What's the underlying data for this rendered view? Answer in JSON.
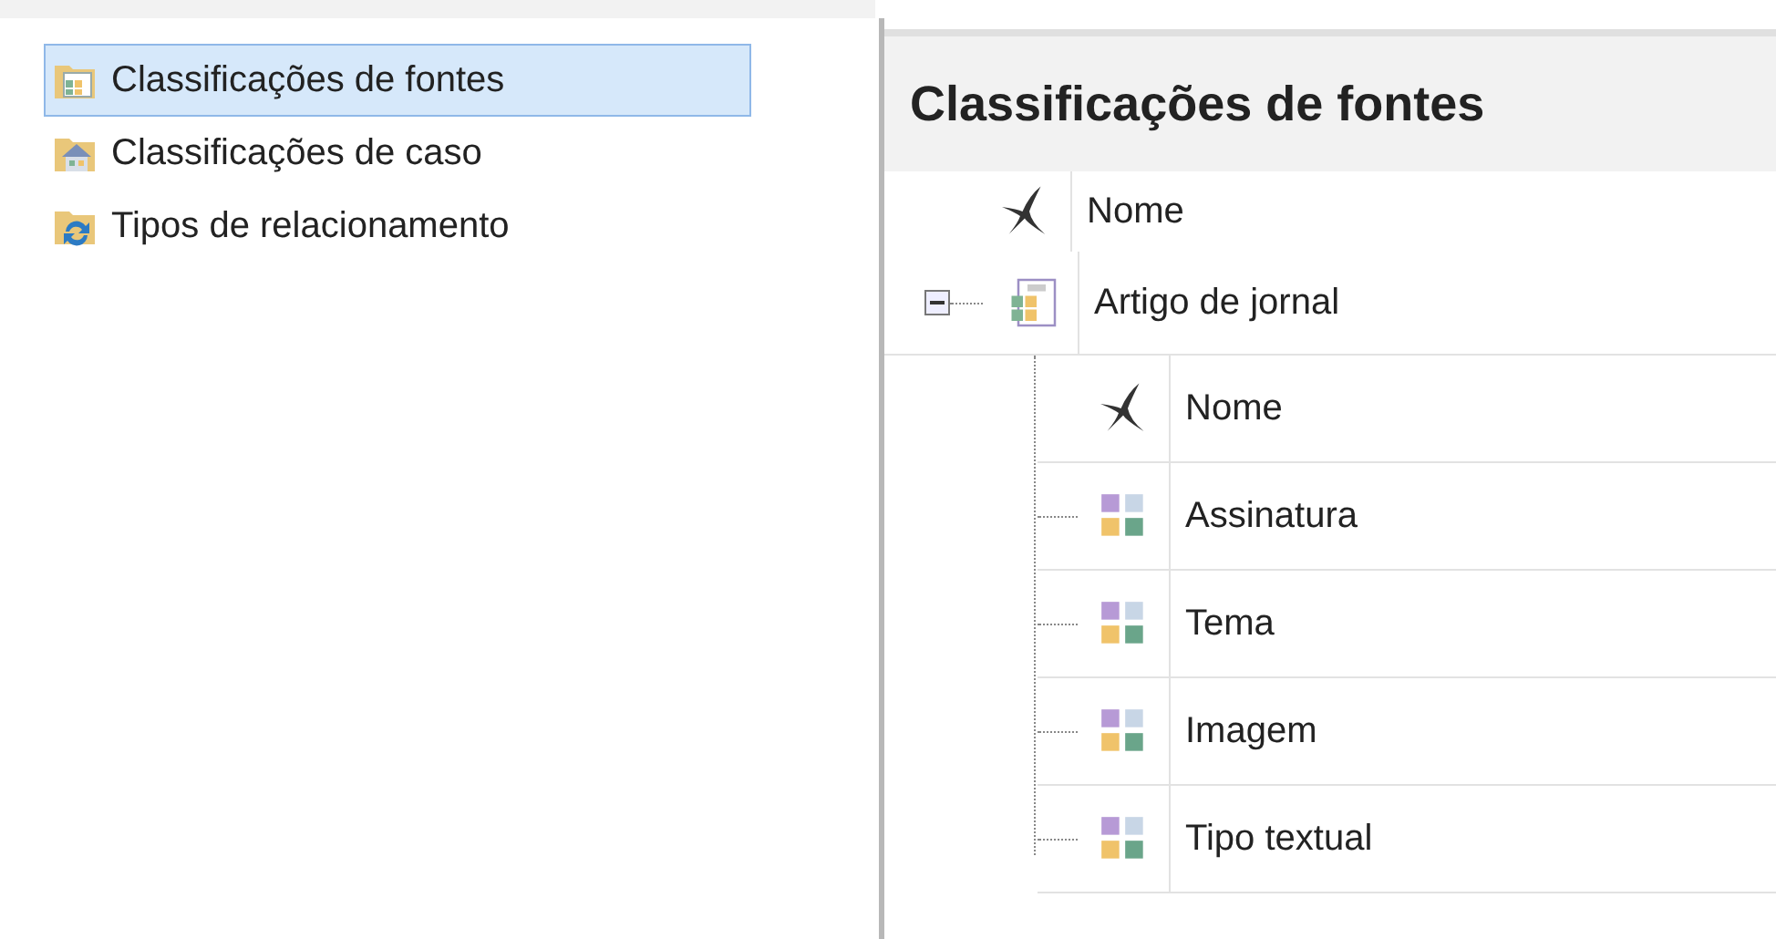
{
  "sidebar": {
    "items": [
      {
        "label": "Classificações de fontes",
        "selected": true,
        "kind": "source"
      },
      {
        "label": "Classificações de caso",
        "selected": false,
        "kind": "case"
      },
      {
        "label": "Tipos de relacionamento",
        "selected": false,
        "kind": "relationship"
      }
    ]
  },
  "panel": {
    "title": "Classificações de fontes",
    "header": "Nome",
    "classifications": [
      {
        "label": "Artigo de jornal",
        "expanded": true,
        "header": "Nome",
        "attributes": [
          {
            "label": "Assinatura"
          },
          {
            "label": "Tema"
          },
          {
            "label": "Imagem"
          },
          {
            "label": "Tipo textual"
          }
        ]
      }
    ]
  }
}
